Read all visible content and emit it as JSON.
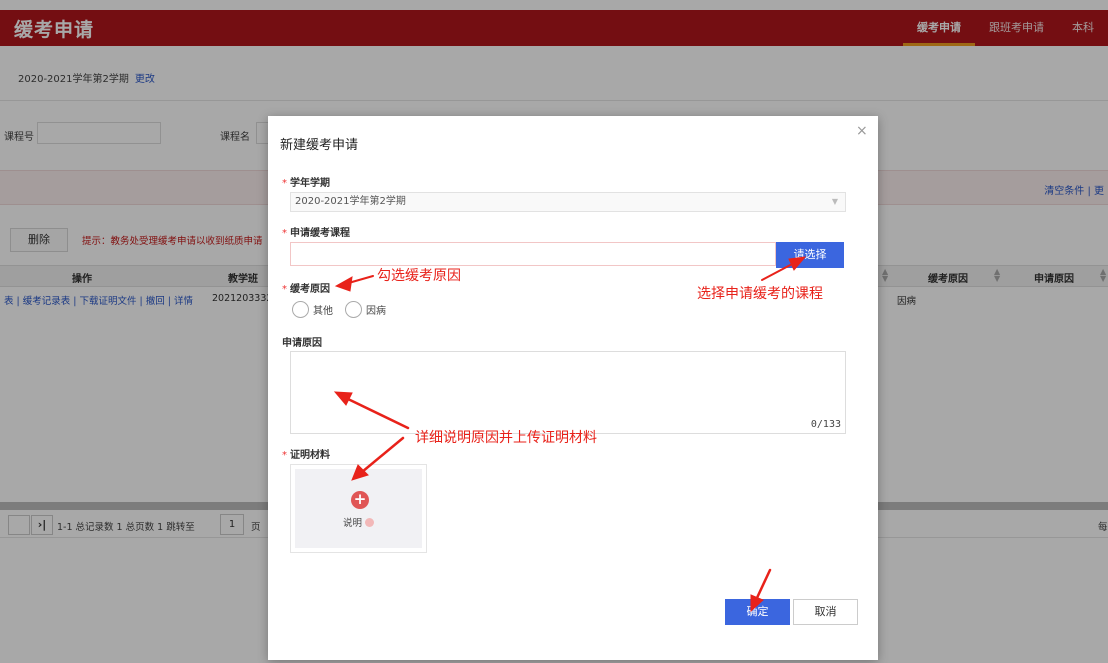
{
  "header": {
    "title": "缓考申请",
    "tabs": [
      "缓考申请",
      "跟班考申请",
      "本科"
    ]
  },
  "page": {
    "term_text": "2020-2021学年第2学期",
    "term_change_link": "更改",
    "filters": {
      "course_no_label": "课程号",
      "course_name_label": "课程名"
    },
    "clear_link": "清空条件 | 更",
    "delete_button": "删除",
    "tip": "提示：教务处受理缓考申请以收到纸质申请",
    "table": {
      "headers": {
        "op": "操作",
        "class": "教学班",
        "reason": "缓考原因",
        "apply_reason": "申请原因"
      },
      "row": {
        "links": "表 | 缓考记录表 | 下载证明文件 | 撤回 | 详情",
        "class_no": "20212033321",
        "reason": "因病",
        "apply_reason": ""
      }
    },
    "pager": {
      "last_btn": "›|",
      "summary": "1-1 总记录数 1   总页数 1   跳转至",
      "page_input": "1",
      "page_unit": "页",
      "right_text": "每"
    }
  },
  "modal": {
    "title": "新建缓考申请",
    "close": "×",
    "term_label": "学年学期",
    "term_value": "2020-2021学年第2学期",
    "course_label": "申请缓考课程",
    "choose_button": "请选择",
    "reason_label": "缓考原因",
    "reason_options": [
      "其他",
      "因病"
    ],
    "apply_reason_label": "申请原因",
    "char_count": "0/133",
    "proof_label": "证明材料",
    "proof_hint": "说明",
    "confirm_button": "确定",
    "cancel_button": "取消"
  },
  "annotations": {
    "reason": "勾选缓考原因",
    "course": "选择申请缓考的课程",
    "detail": "详细说明原因并上传证明材料"
  },
  "colors": {
    "brand": "#b0161c",
    "primary": "#3b66df",
    "annotation": "#e8221a"
  }
}
